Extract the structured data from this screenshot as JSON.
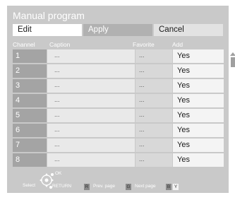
{
  "title": "Manual program",
  "tabs": {
    "edit": "Edit",
    "apply": "Apply",
    "cancel": "Cancel"
  },
  "headers": {
    "channel": "Channel",
    "caption": "Caption",
    "favorite": "Favorite",
    "add": "Add"
  },
  "rows": [
    {
      "channel": "1",
      "caption": "...",
      "favorite": "...",
      "add": "Yes"
    },
    {
      "channel": "2",
      "caption": "...",
      "favorite": "...",
      "add": "Yes"
    },
    {
      "channel": "3",
      "caption": "...",
      "favorite": "...",
      "add": "Yes"
    },
    {
      "channel": "4",
      "caption": "...",
      "favorite": "...",
      "add": "Yes"
    },
    {
      "channel": "5",
      "caption": "...",
      "favorite": "...",
      "add": "Yes"
    },
    {
      "channel": "6",
      "caption": "...",
      "favorite": "...",
      "add": "Yes"
    },
    {
      "channel": "7",
      "caption": "...",
      "favorite": "...",
      "add": "Yes"
    },
    {
      "channel": "8",
      "caption": "...",
      "favorite": "...",
      "add": "Yes"
    }
  ],
  "footer": {
    "select": "Select",
    "ok": "OK",
    "return": "RETURN",
    "key_r": "R",
    "prev_page": "Prev. page",
    "key_g": "G",
    "next_page": "Next page",
    "key_b": "B",
    "key_y": "Y"
  },
  "colors": {
    "panel": "#c9c9c9",
    "active_tab": "#ffffff",
    "key_r": "#8a8a8a",
    "key_g": "#8a8a8a",
    "key_b": "#8a8a8a",
    "key_y": "#f2f2f2"
  }
}
